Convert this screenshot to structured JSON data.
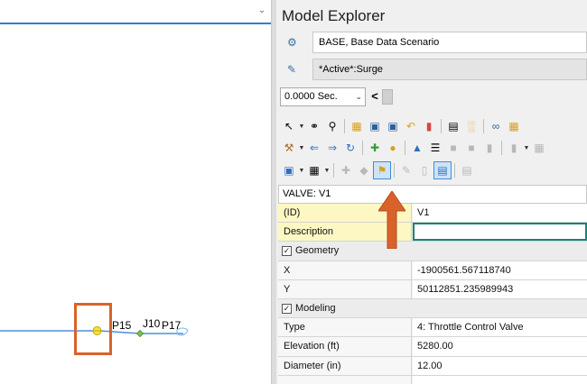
{
  "canvas": {
    "chevron_icon": "chevron-down-icon",
    "labels": {
      "p15": "P15",
      "j10": "J10",
      "p17": "P17"
    },
    "pipe_color": "#4a90d9",
    "valve_color": "#e6d21f",
    "junction_color": "#6ab04c"
  },
  "explorer": {
    "title": "Model Explorer",
    "base_scenario": {
      "icon": "scenario-icon",
      "label": "BASE, Base Data Scenario"
    },
    "active_scenario": {
      "icon": "scenario-active-icon",
      "label": "*Active*:Surge"
    },
    "time": {
      "value": "0.0000 Sec.",
      "prev_label": "<"
    },
    "accent_color": "#3f8cd8"
  },
  "property_grid": {
    "header": "VALVE: V1",
    "rows": {
      "id": {
        "name": "(ID)",
        "value": "V1"
      },
      "description": {
        "name": "Description",
        "value": ""
      },
      "geometry": {
        "name": "Geometry"
      },
      "x": {
        "name": "X",
        "value": "-1900561.567118740"
      },
      "y": {
        "name": "Y",
        "value": "50112851.235989943"
      },
      "modeling": {
        "name": "Modeling"
      },
      "type": {
        "name": "Type",
        "value": "4: Throttle Control Valve"
      },
      "elevation": {
        "name": "Elevation (ft)",
        "value": "5280.00"
      },
      "diameter": {
        "name": "Diameter (in)",
        "value": "12.00"
      }
    }
  },
  "annotations": {
    "highlight_color": "#d9622b",
    "arrow_color": "#d9622b"
  }
}
